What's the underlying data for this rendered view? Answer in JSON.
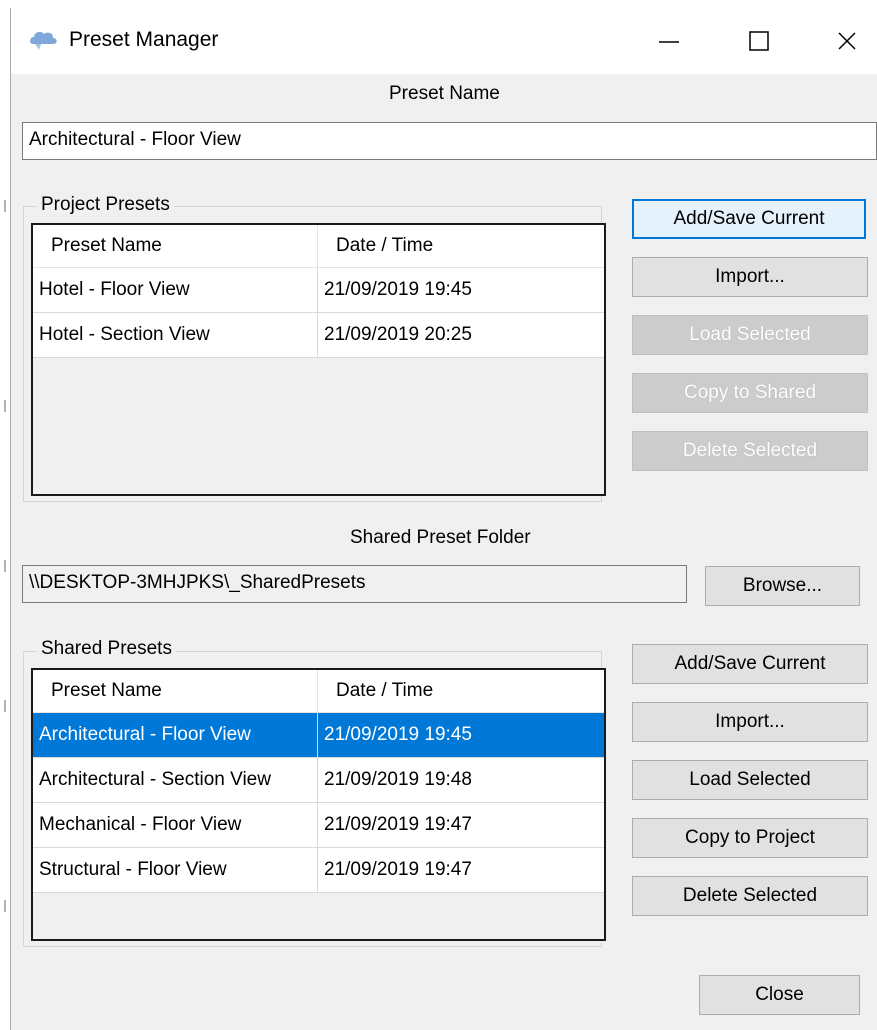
{
  "window": {
    "title": "Preset Manager"
  },
  "preset_name": {
    "label": "Preset Name",
    "value": "Architectural - Floor View"
  },
  "project_presets": {
    "group_label": "Project Presets",
    "columns": [
      "Preset Name",
      "Date / Time"
    ],
    "rows": [
      {
        "name": "Hotel - Floor View",
        "datetime": "21/09/2019 19:45"
      },
      {
        "name": "Hotel - Section View",
        "datetime": "21/09/2019 20:25"
      }
    ],
    "buttons": {
      "add_save": "Add/Save Current",
      "import": "Import...",
      "load_selected": "Load Selected",
      "copy": "Copy to Shared",
      "delete_selected": "Delete Selected"
    }
  },
  "shared_folder": {
    "label": "Shared Preset Folder",
    "value": "\\\\DESKTOP-3MHJPKS\\_SharedPresets",
    "browse_label": "Browse..."
  },
  "shared_presets": {
    "group_label": "Shared Presets",
    "columns": [
      "Preset Name",
      "Date / Time"
    ],
    "rows": [
      {
        "name": "Architectural - Floor View",
        "datetime": "21/09/2019 19:45",
        "selected": true
      },
      {
        "name": "Architectural - Section View",
        "datetime": "21/09/2019 19:48",
        "selected": false
      },
      {
        "name": "Mechanical - Floor View",
        "datetime": "21/09/2019 19:47",
        "selected": false
      },
      {
        "name": "Structural - Floor View",
        "datetime": "21/09/2019 19:47",
        "selected": false
      }
    ],
    "buttons": {
      "add_save": "Add/Save Current",
      "import": "Import...",
      "load_selected": "Load Selected",
      "copy": "Copy to Project",
      "delete_selected": "Delete Selected"
    }
  },
  "footer": {
    "close_label": "Close"
  },
  "colors": {
    "selection": "#0078d7",
    "window_bg": "#f0f0f0",
    "button_bg": "#e1e1e1",
    "disabled_button_bg": "#cccccc"
  },
  "icons": {
    "app": "cloud-icon",
    "minimize": "minimize-icon",
    "maximize": "maximize-icon",
    "close": "close-icon"
  }
}
